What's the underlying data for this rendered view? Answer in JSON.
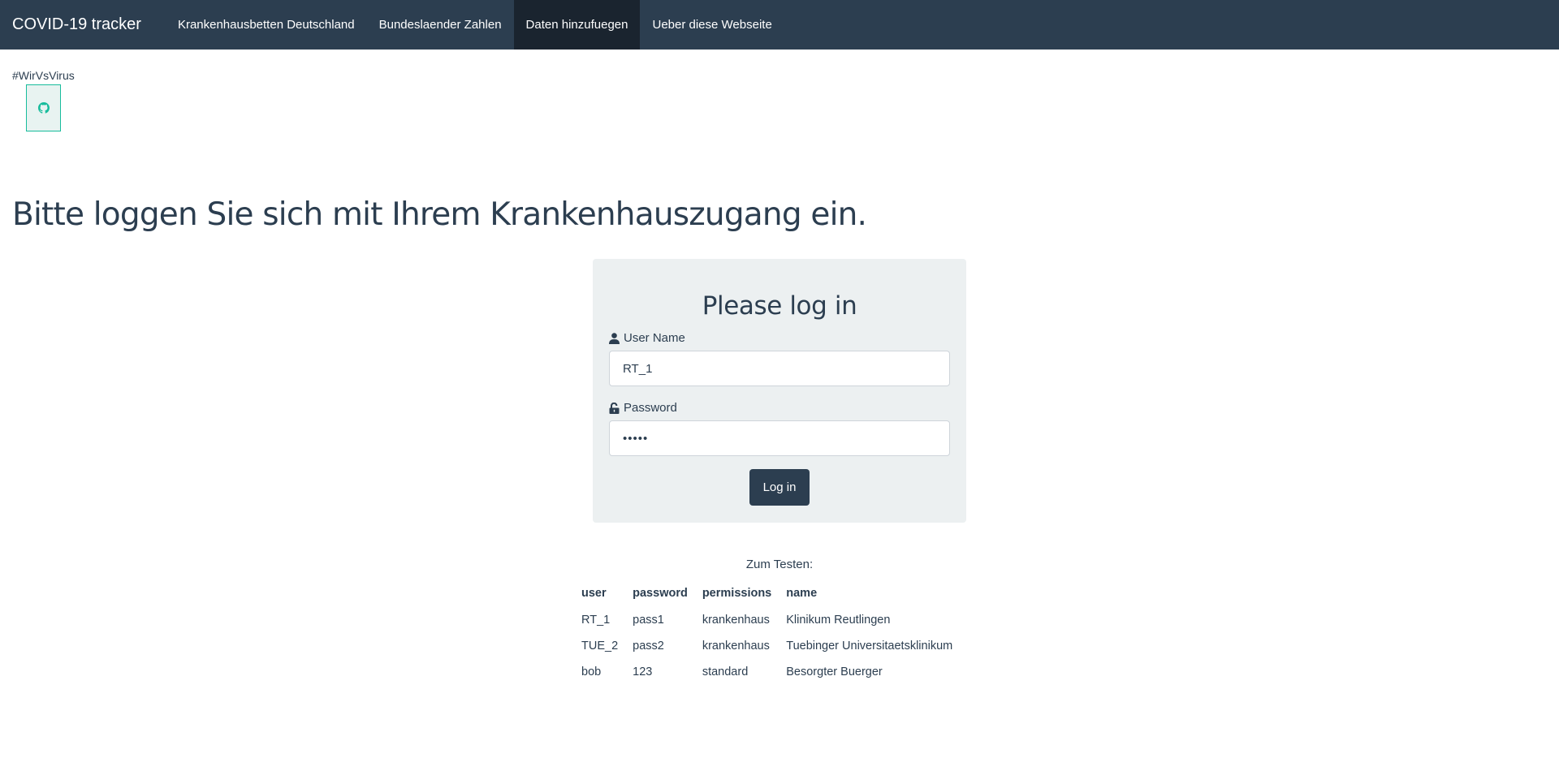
{
  "navbar": {
    "brand": "COVID-19 tracker",
    "items": [
      {
        "label": "Krankenhausbetten Deutschland",
        "active": false
      },
      {
        "label": "Bundeslaender Zahlen",
        "active": false
      },
      {
        "label": "Daten hinzufuegen",
        "active": true
      },
      {
        "label": "Ueber diese Webseite",
        "active": false
      }
    ]
  },
  "hashtag": "#WirVsVirus",
  "github_icon": "github-icon",
  "heading": "Bitte loggen Sie sich mit Ihrem Krankenhauszugang ein.",
  "login": {
    "title": "Please log in",
    "username_label": "User Name",
    "username_value": "RT_1",
    "username_icon": "user-icon",
    "password_label": "Password",
    "password_value": "•••••",
    "password_icon": "unlock-icon",
    "button": "Log in"
  },
  "test": {
    "caption": "Zum Testen:",
    "headers": [
      "user",
      "password",
      "permissions",
      "name"
    ],
    "rows": [
      [
        "RT_1",
        "pass1",
        "krankenhaus",
        "Klinikum Reutlingen"
      ],
      [
        "TUE_2",
        "pass2",
        "krankenhaus",
        "Tuebinger Universitaetsklinikum"
      ],
      [
        "bob",
        "123",
        "standard",
        "Besorgter Buerger"
      ]
    ]
  },
  "colors": {
    "navbar": "#2c3e50",
    "navbar_active": "#1a242f",
    "card": "#ecf0f1",
    "accent": "#18bc9c",
    "text": "#2c3e50"
  }
}
